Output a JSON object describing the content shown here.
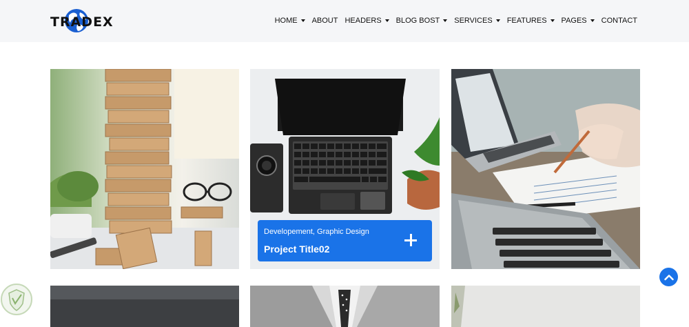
{
  "brand": {
    "logo_text": "TRADEX",
    "accent": "#1a73e8"
  },
  "nav": {
    "items": [
      {
        "label": "HOME",
        "dropdown": true
      },
      {
        "label": "ABOUT",
        "dropdown": false
      },
      {
        "label": "HEADERS",
        "dropdown": true
      },
      {
        "label": "BLOG BOST",
        "dropdown": true
      },
      {
        "label": "SERVICES",
        "dropdown": true
      },
      {
        "label": "FEATURES",
        "dropdown": true
      },
      {
        "label": "PAGES",
        "dropdown": true
      },
      {
        "label": "CONTACT",
        "dropdown": false
      }
    ]
  },
  "portfolio": {
    "hover_card": {
      "categories": "Developement, Graphic Design",
      "title": "Project Title02"
    }
  },
  "icons": [
    "globe-icon",
    "chevron-up-icon",
    "plus-icon",
    "shield-badge-icon"
  ]
}
